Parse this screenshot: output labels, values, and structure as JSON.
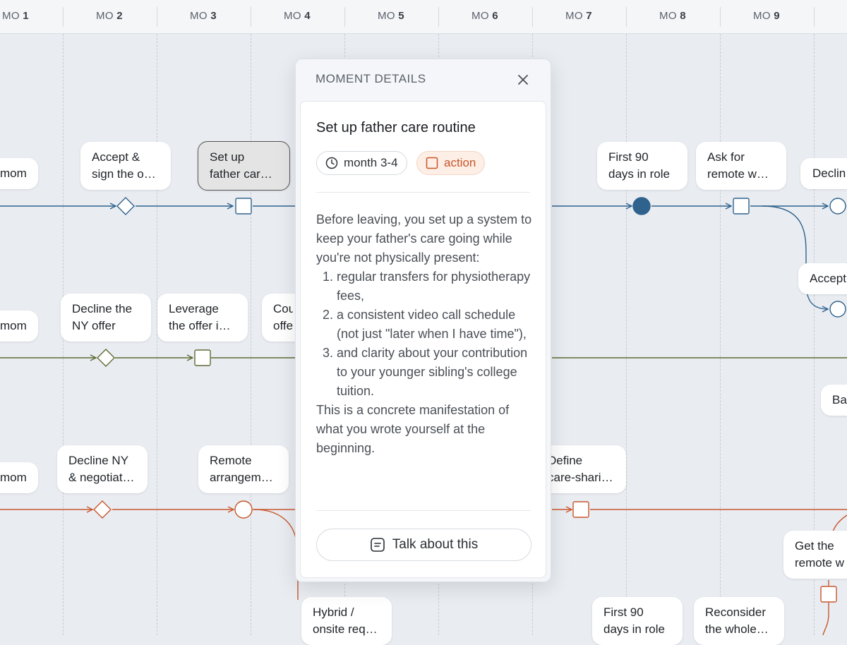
{
  "timeline": {
    "months": [
      {
        "prefix": "MO",
        "num": "1"
      },
      {
        "prefix": "MO",
        "num": "2"
      },
      {
        "prefix": "MO",
        "num": "3"
      },
      {
        "prefix": "MO",
        "num": "4"
      },
      {
        "prefix": "MO",
        "num": "5"
      },
      {
        "prefix": "MO",
        "num": "6"
      },
      {
        "prefix": "MO",
        "num": "7"
      },
      {
        "prefix": "MO",
        "num": "8"
      },
      {
        "prefix": "MO",
        "num": "9"
      }
    ],
    "colors": {
      "lane1": "#2f628c",
      "lane2": "#5f6a34",
      "lane3": "#c9562d"
    }
  },
  "nodes": {
    "l1_mom": {
      "line1": "mom",
      "line2": ""
    },
    "l1_accept": {
      "line1": "Accept &",
      "line2": "sign the o…"
    },
    "l1_setup": {
      "line1": "Set up",
      "line2": "father car…"
    },
    "l1_first90": {
      "line1": "First 90",
      "line2": "days in role"
    },
    "l1_askremote": {
      "line1": "Ask for",
      "line2": "remote w…"
    },
    "l1_decline": {
      "line1": "Declin",
      "line2": ""
    },
    "l1_accept2": {
      "line1": "Accept",
      "line2": ""
    },
    "l2_mom": {
      "line1": "mom",
      "line2": ""
    },
    "l2_decline": {
      "line1": "Decline the",
      "line2": "NY offer"
    },
    "l2_leverage": {
      "line1": "Leverage",
      "line2": "the offer i…"
    },
    "l2_counter": {
      "line1": "Cou",
      "line2": "offe"
    },
    "l2_ba": {
      "line1": "Ba",
      "line2": ""
    },
    "l3_mom": {
      "line1": "mom",
      "line2": ""
    },
    "l3_declineny": {
      "line1": "Decline NY",
      "line2": "& negotiat…"
    },
    "l3_remote": {
      "line1": "Remote",
      "line2": "arrangem…"
    },
    "l3_define": {
      "line1": "Define",
      "line2": "care-shari…"
    },
    "l3_getremote": {
      "line1": "Get the",
      "line2": "remote w"
    },
    "l3_hybrid": {
      "line1": "Hybrid /",
      "line2": "onsite req…"
    },
    "l3_first90": {
      "line1": "First 90",
      "line2": "days in role"
    },
    "l3_reconsider": {
      "line1": "Reconsider",
      "line2": "the whole…"
    }
  },
  "panel": {
    "header": "MOMENT DETAILS",
    "title": "Set up father care routine",
    "time_label": "month 3-4",
    "type_label": "action",
    "intro": "Before leaving, you set up a system to keep your father's care going while you're not physically present:",
    "items": [
      "regular transfers for physiotherapy fees,",
      "a consistent video call schedule (not just \"later when I have time\"),",
      "and clarity about your contribution to your younger sibling's college tuition."
    ],
    "outro": "This is a concrete manifestation of what you wrote yourself at the beginning.",
    "talk_label": "Talk about this"
  }
}
